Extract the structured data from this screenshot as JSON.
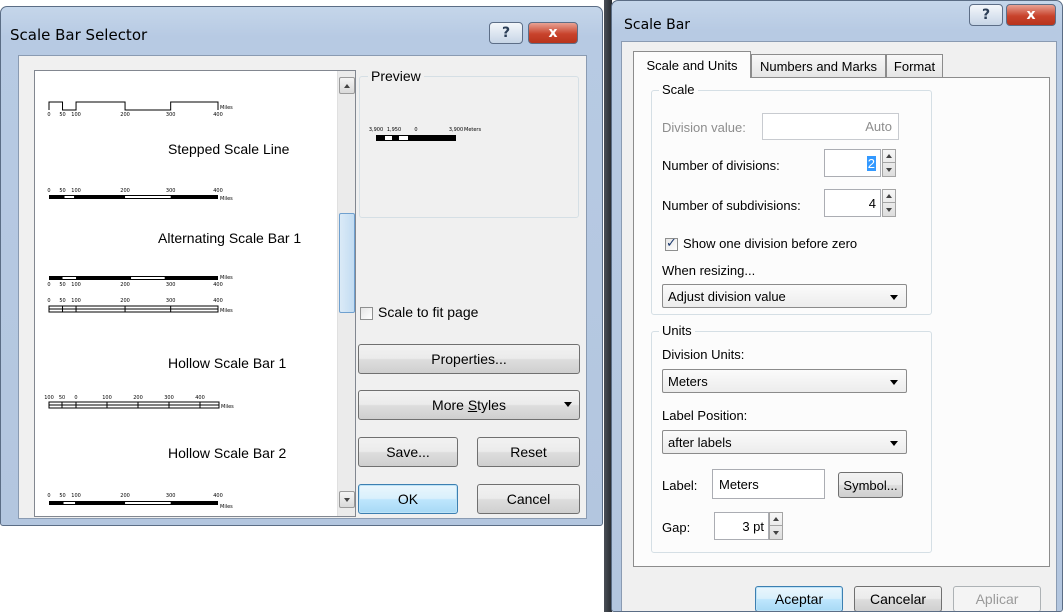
{
  "left_dialog": {
    "title": "Scale Bar Selector",
    "help_label": "?",
    "close_label": "x",
    "styles": [
      {
        "name": "Stepped Scale Line",
        "ticks": [
          "0",
          "50",
          "100",
          "200",
          "300",
          "400"
        ],
        "unit": "Miles"
      },
      {
        "name": "Alternating Scale Bar 1",
        "ticks": [
          "0",
          "50",
          "100",
          "200",
          "300",
          "400"
        ],
        "unit": "Miles"
      },
      {
        "name": "",
        "ticks": [
          "0",
          "50",
          "100",
          "200",
          "300",
          "400"
        ],
        "unit": "Miles"
      },
      {
        "name": "Hollow Scale Bar 1",
        "ticks": [
          "0",
          "50",
          "100",
          "200",
          "300",
          "400"
        ],
        "unit": "Miles"
      },
      {
        "name": "Hollow Scale Bar 2",
        "ticks": [
          "100",
          "50",
          "0",
          "100",
          "200",
          "300",
          "400"
        ],
        "unit": "Miles"
      },
      {
        "name": "",
        "ticks": [
          "0",
          "50",
          "100",
          "200",
          "300",
          "400"
        ],
        "unit": "Miles"
      }
    ],
    "preview": {
      "label": "Preview",
      "ticks": [
        "3,900",
        "1,950",
        "0",
        "3,900"
      ],
      "unit": "Meters"
    },
    "scale_to_fit_label": "Scale to fit page",
    "scale_to_fit_checked": false,
    "properties_label": "Properties...",
    "more_styles_label_pre": "More ",
    "more_styles_label_ul": "S",
    "more_styles_label_post": "tyles",
    "save_label": "Save...",
    "reset_label": "Reset",
    "ok_label": "OK",
    "cancel_label": "Cancel"
  },
  "right_dialog": {
    "title": "Scale Bar",
    "help_label": "?",
    "close_label": "x",
    "tabs": [
      "Scale and Units",
      "Numbers and Marks",
      "Format"
    ],
    "active_tab": "Scale and Units",
    "scale_group": {
      "label": "Scale",
      "division_value_label": "Division value:",
      "division_value": "Auto",
      "num_divisions_label": "Number of divisions:",
      "num_divisions": "2",
      "num_subdivisions_label": "Number of subdivisions:",
      "num_subdivisions": "4",
      "show_one_division_label": "Show one division before zero",
      "show_one_division_checked": true,
      "when_resizing_label": "When resizing...",
      "when_resizing_value": "Adjust division value"
    },
    "units_group": {
      "label": "Units",
      "division_units_label": "Division Units:",
      "division_units_value": "Meters",
      "label_position_label": "Label Position:",
      "label_position_value": "after labels",
      "label_label": "Label:",
      "label_value": "Meters",
      "symbol_label": "Symbol...",
      "gap_label": "Gap:",
      "gap_value": "3 pt"
    },
    "accept_label": "Aceptar",
    "cancel_label": "Cancelar",
    "apply_label": "Aplicar"
  },
  "colors": {
    "title_gradient_top": "#c5d6ea",
    "close_red": "#c8432c",
    "default_button_blue": "#bee6fd",
    "scroll_thumb": "#c2dcf2"
  }
}
